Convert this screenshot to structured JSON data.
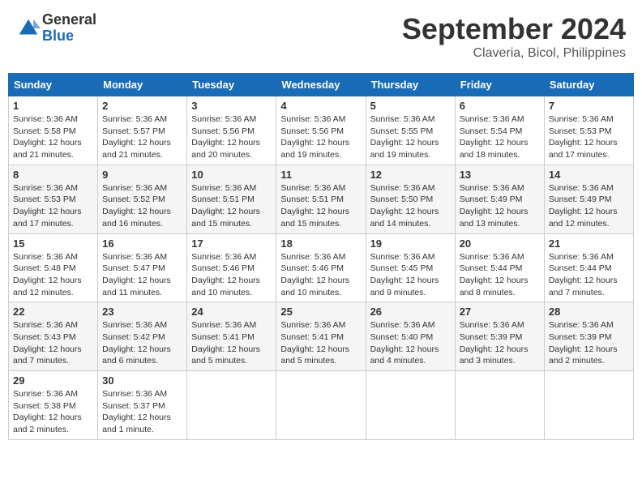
{
  "header": {
    "logo_general": "General",
    "logo_blue": "Blue",
    "month": "September 2024",
    "location": "Claveria, Bicol, Philippines"
  },
  "weekdays": [
    "Sunday",
    "Monday",
    "Tuesday",
    "Wednesday",
    "Thursday",
    "Friday",
    "Saturday"
  ],
  "weeks": [
    [
      {
        "day": "1",
        "sunrise": "Sunrise: 5:36 AM",
        "sunset": "Sunset: 5:58 PM",
        "daylight": "Daylight: 12 hours and 21 minutes."
      },
      {
        "day": "2",
        "sunrise": "Sunrise: 5:36 AM",
        "sunset": "Sunset: 5:57 PM",
        "daylight": "Daylight: 12 hours and 21 minutes."
      },
      {
        "day": "3",
        "sunrise": "Sunrise: 5:36 AM",
        "sunset": "Sunset: 5:56 PM",
        "daylight": "Daylight: 12 hours and 20 minutes."
      },
      {
        "day": "4",
        "sunrise": "Sunrise: 5:36 AM",
        "sunset": "Sunset: 5:56 PM",
        "daylight": "Daylight: 12 hours and 19 minutes."
      },
      {
        "day": "5",
        "sunrise": "Sunrise: 5:36 AM",
        "sunset": "Sunset: 5:55 PM",
        "daylight": "Daylight: 12 hours and 19 minutes."
      },
      {
        "day": "6",
        "sunrise": "Sunrise: 5:36 AM",
        "sunset": "Sunset: 5:54 PM",
        "daylight": "Daylight: 12 hours and 18 minutes."
      },
      {
        "day": "7",
        "sunrise": "Sunrise: 5:36 AM",
        "sunset": "Sunset: 5:53 PM",
        "daylight": "Daylight: 12 hours and 17 minutes."
      }
    ],
    [
      {
        "day": "8",
        "sunrise": "Sunrise: 5:36 AM",
        "sunset": "Sunset: 5:53 PM",
        "daylight": "Daylight: 12 hours and 17 minutes."
      },
      {
        "day": "9",
        "sunrise": "Sunrise: 5:36 AM",
        "sunset": "Sunset: 5:52 PM",
        "daylight": "Daylight: 12 hours and 16 minutes."
      },
      {
        "day": "10",
        "sunrise": "Sunrise: 5:36 AM",
        "sunset": "Sunset: 5:51 PM",
        "daylight": "Daylight: 12 hours and 15 minutes."
      },
      {
        "day": "11",
        "sunrise": "Sunrise: 5:36 AM",
        "sunset": "Sunset: 5:51 PM",
        "daylight": "Daylight: 12 hours and 15 minutes."
      },
      {
        "day": "12",
        "sunrise": "Sunrise: 5:36 AM",
        "sunset": "Sunset: 5:50 PM",
        "daylight": "Daylight: 12 hours and 14 minutes."
      },
      {
        "day": "13",
        "sunrise": "Sunrise: 5:36 AM",
        "sunset": "Sunset: 5:49 PM",
        "daylight": "Daylight: 12 hours and 13 minutes."
      },
      {
        "day": "14",
        "sunrise": "Sunrise: 5:36 AM",
        "sunset": "Sunset: 5:49 PM",
        "daylight": "Daylight: 12 hours and 12 minutes."
      }
    ],
    [
      {
        "day": "15",
        "sunrise": "Sunrise: 5:36 AM",
        "sunset": "Sunset: 5:48 PM",
        "daylight": "Daylight: 12 hours and 12 minutes."
      },
      {
        "day": "16",
        "sunrise": "Sunrise: 5:36 AM",
        "sunset": "Sunset: 5:47 PM",
        "daylight": "Daylight: 12 hours and 11 minutes."
      },
      {
        "day": "17",
        "sunrise": "Sunrise: 5:36 AM",
        "sunset": "Sunset: 5:46 PM",
        "daylight": "Daylight: 12 hours and 10 minutes."
      },
      {
        "day": "18",
        "sunrise": "Sunrise: 5:36 AM",
        "sunset": "Sunset: 5:46 PM",
        "daylight": "Daylight: 12 hours and 10 minutes."
      },
      {
        "day": "19",
        "sunrise": "Sunrise: 5:36 AM",
        "sunset": "Sunset: 5:45 PM",
        "daylight": "Daylight: 12 hours and 9 minutes."
      },
      {
        "day": "20",
        "sunrise": "Sunrise: 5:36 AM",
        "sunset": "Sunset: 5:44 PM",
        "daylight": "Daylight: 12 hours and 8 minutes."
      },
      {
        "day": "21",
        "sunrise": "Sunrise: 5:36 AM",
        "sunset": "Sunset: 5:44 PM",
        "daylight": "Daylight: 12 hours and 7 minutes."
      }
    ],
    [
      {
        "day": "22",
        "sunrise": "Sunrise: 5:36 AM",
        "sunset": "Sunset: 5:43 PM",
        "daylight": "Daylight: 12 hours and 7 minutes."
      },
      {
        "day": "23",
        "sunrise": "Sunrise: 5:36 AM",
        "sunset": "Sunset: 5:42 PM",
        "daylight": "Daylight: 12 hours and 6 minutes."
      },
      {
        "day": "24",
        "sunrise": "Sunrise: 5:36 AM",
        "sunset": "Sunset: 5:41 PM",
        "daylight": "Daylight: 12 hours and 5 minutes."
      },
      {
        "day": "25",
        "sunrise": "Sunrise: 5:36 AM",
        "sunset": "Sunset: 5:41 PM",
        "daylight": "Daylight: 12 hours and 5 minutes."
      },
      {
        "day": "26",
        "sunrise": "Sunrise: 5:36 AM",
        "sunset": "Sunset: 5:40 PM",
        "daylight": "Daylight: 12 hours and 4 minutes."
      },
      {
        "day": "27",
        "sunrise": "Sunrise: 5:36 AM",
        "sunset": "Sunset: 5:39 PM",
        "daylight": "Daylight: 12 hours and 3 minutes."
      },
      {
        "day": "28",
        "sunrise": "Sunrise: 5:36 AM",
        "sunset": "Sunset: 5:39 PM",
        "daylight": "Daylight: 12 hours and 2 minutes."
      }
    ],
    [
      {
        "day": "29",
        "sunrise": "Sunrise: 5:36 AM",
        "sunset": "Sunset: 5:38 PM",
        "daylight": "Daylight: 12 hours and 2 minutes."
      },
      {
        "day": "30",
        "sunrise": "Sunrise: 5:36 AM",
        "sunset": "Sunset: 5:37 PM",
        "daylight": "Daylight: 12 hours and 1 minute."
      },
      null,
      null,
      null,
      null,
      null
    ]
  ]
}
